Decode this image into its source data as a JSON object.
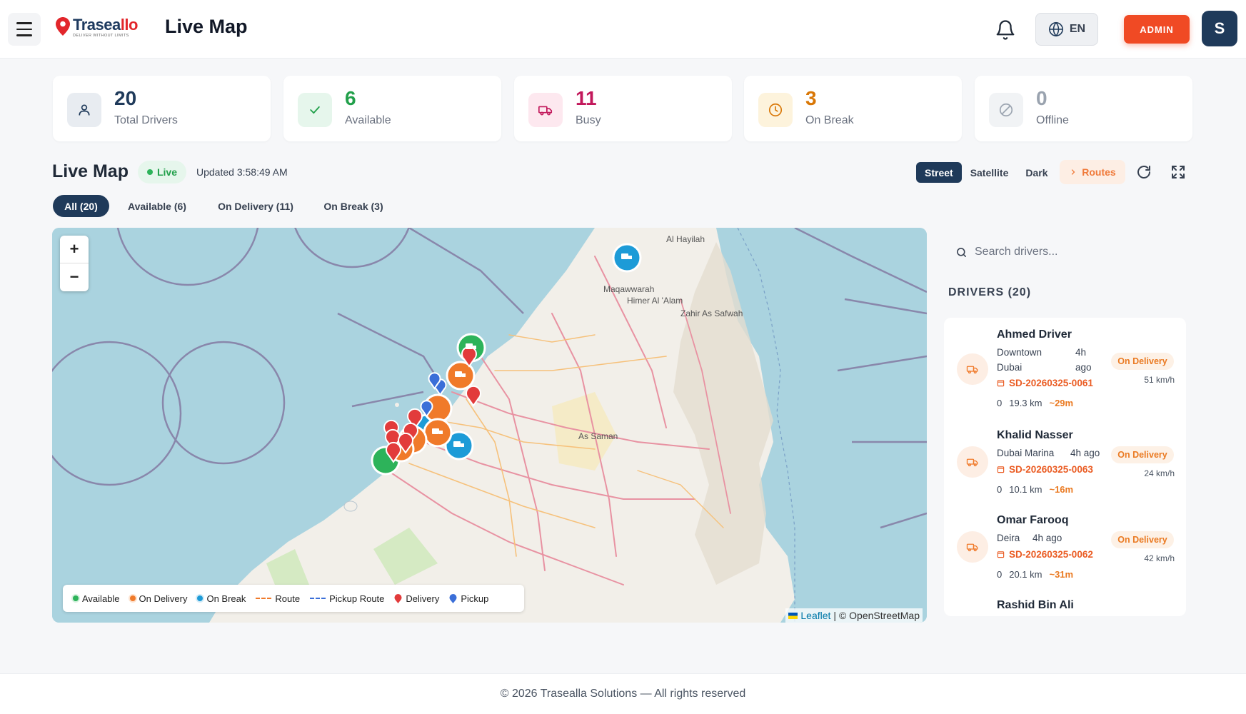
{
  "header": {
    "logo_text_a": "Trasea",
    "logo_text_b": "llo",
    "logo_tagline": "DELIVER WITHOUT LIMITS",
    "page_title": "Live Map",
    "language": "EN",
    "admin_label": "ADMIN",
    "avatar_initial": "S"
  },
  "stats": [
    {
      "value": "20",
      "label": "Total Drivers",
      "color": "#1f3a5a",
      "icon_bg": "#e8ecf1",
      "icon": "user-icon"
    },
    {
      "value": "6",
      "label": "Available",
      "color": "#22a04b",
      "icon_bg": "#e6f6ec",
      "icon": "check-icon"
    },
    {
      "value": "11",
      "label": "Busy",
      "color": "#c2185b",
      "icon_bg": "#fde8ef",
      "icon": "truck-icon"
    },
    {
      "value": "3",
      "label": "On Break",
      "color": "#d97706",
      "icon_bg": "#fdf3dc",
      "icon": "clock-icon"
    },
    {
      "value": "0",
      "label": "Offline",
      "color": "#9aa3af",
      "icon_bg": "#f1f3f5",
      "icon": "slash-circle-icon"
    }
  ],
  "map_header": {
    "title": "Live Map",
    "live_label": "Live",
    "updated": "Updated 3:58:49 AM",
    "styles": [
      "Street",
      "Satellite",
      "Dark"
    ],
    "active_style": "Street",
    "routes_label": "Routes"
  },
  "filters": [
    {
      "label": "All (20)",
      "active": true
    },
    {
      "label": "Available (6)",
      "active": false
    },
    {
      "label": "On Delivery (11)",
      "active": false
    },
    {
      "label": "On Break (3)",
      "active": false
    }
  ],
  "map": {
    "place_labels": [
      "Al Hayilah",
      "Maqawwarah",
      "Himer Al 'Alam",
      "Zahir As Safwah",
      "As Saman"
    ],
    "legend": {
      "available": "Available",
      "on_delivery": "On Delivery",
      "on_break": "On Break",
      "route": "Route",
      "pickup_route": "Pickup Route",
      "delivery": "Delivery",
      "pickup": "Pickup"
    },
    "attribution_leaflet": "Leaflet",
    "attribution_osm": "| © OpenStreetMap",
    "colors": {
      "available": "#2db35a",
      "on_delivery": "#f07a2a",
      "on_break": "#1d9bd7",
      "delivery": "#e23b3b",
      "pickup": "#3b6fd8"
    }
  },
  "sidebar": {
    "search_placeholder": "Search drivers...",
    "drivers_title": "DRIVERS (20)",
    "drivers": [
      {
        "name": "Ahmed Driver",
        "loc1": "Downtown",
        "loc2": "Dubai",
        "time1": "4h",
        "time2": "ago",
        "order": "SD-20260325-0061",
        "count": "0",
        "distance": "19.3 km",
        "eta": "~29m",
        "status": "On Delivery",
        "speed": "51 km/h"
      },
      {
        "name": "Khalid Nasser",
        "loc1": "Dubai Marina",
        "time1": "4h ago",
        "order": "SD-20260325-0063",
        "count": "0",
        "distance": "10.1 km",
        "eta": "~16m",
        "status": "On Delivery",
        "speed": "24 km/h"
      },
      {
        "name": "Omar Farooq",
        "loc1": "Deira",
        "time1": "4h ago",
        "order": "SD-20260325-0062",
        "count": "0",
        "distance": "20.1 km",
        "eta": "~31m",
        "status": "On Delivery",
        "speed": "42 km/h"
      },
      {
        "name": "Rashid Bin Ali"
      }
    ]
  },
  "footer": {
    "text": "© 2026 Trasealla Solutions — All rights reserved"
  }
}
